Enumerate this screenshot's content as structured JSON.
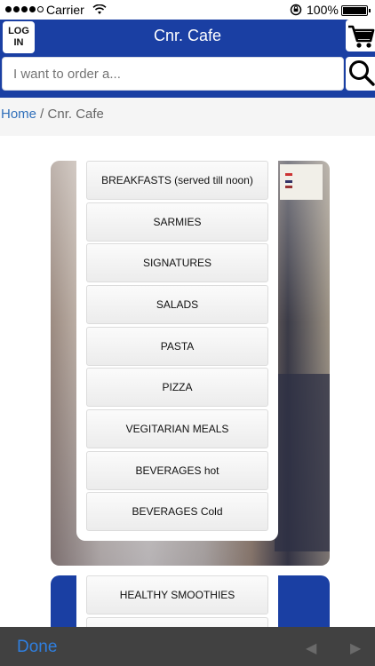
{
  "status_bar": {
    "carrier": "Carrier",
    "time": "",
    "battery": "100%",
    "icons": [
      "signal-dots-icon",
      "wifi-icon",
      "rotation-lock-icon",
      "battery-icon"
    ]
  },
  "header": {
    "login_label": "LOG\nIN",
    "title": "Cnr. Cafe",
    "search_placeholder": "I want to order a...",
    "icons": [
      "cart-icon",
      "search-icon"
    ],
    "brand_color": "#1a3fa3"
  },
  "breadcrumb": {
    "home": "Home",
    "separator": " / ",
    "current": "Cnr. Cafe"
  },
  "menu": {
    "items": [
      "BREAKFASTS (served till noon)",
      "SARMIES",
      "SIGNATURES",
      "SALADS",
      "PASTA",
      "PIZZA",
      "VEGITARIAN MEALS",
      "BEVERAGES hot",
      "BEVERAGES Cold"
    ],
    "second_card_item": "HEALTHY SMOOTHIES"
  },
  "toolbar": {
    "done_label": "Done",
    "prev_arrow": "◀",
    "next_arrow": "▶"
  }
}
